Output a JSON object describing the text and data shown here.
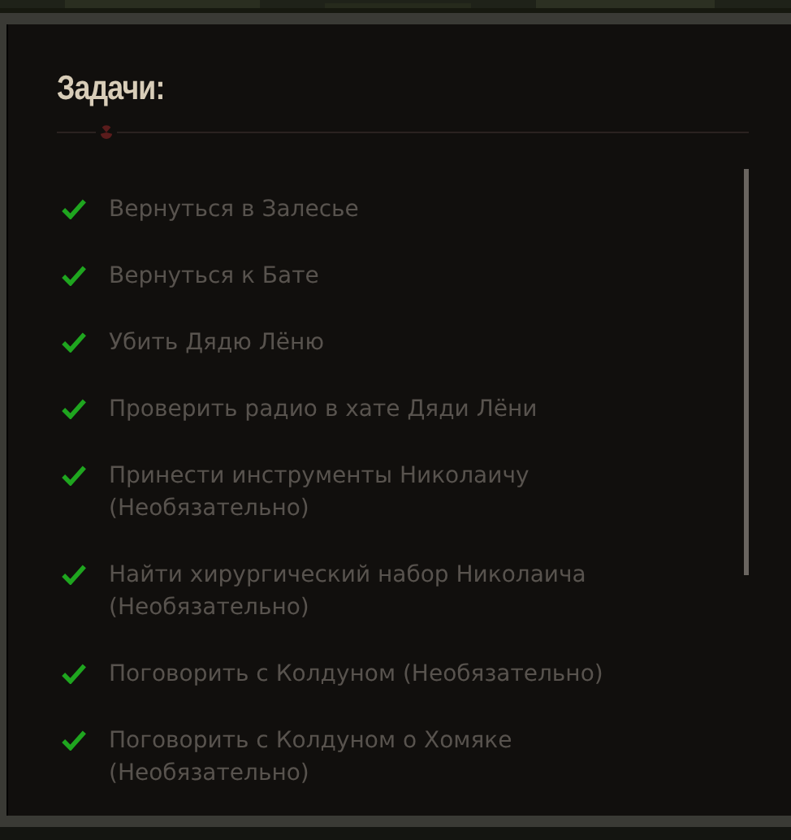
{
  "panel": {
    "title": "Задачи:"
  },
  "tasks": [
    {
      "text": "Вернуться в Залесье",
      "done": true
    },
    {
      "text": "Вернуться к Бате",
      "done": true
    },
    {
      "text": "Убить Дядю Лёню",
      "done": true
    },
    {
      "text": "Проверить радио в хате Дяди Лёни",
      "done": true
    },
    {
      "text": "Принести инструменты Николаичу (Необязательно)",
      "done": true
    },
    {
      "text": "Найти хирургический набор Николаича (Необязательно)",
      "done": true
    },
    {
      "text": "Поговорить с Колдуном (Необязательно)",
      "done": true
    },
    {
      "text": "Поговорить с Колдуном о Хомяке (Необязательно)",
      "done": true
    }
  ]
}
